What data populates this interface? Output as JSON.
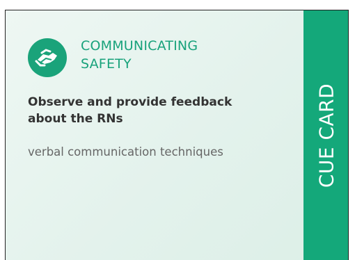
{
  "card": {
    "title_line1": "COMMUNICATING",
    "title_line2": "SAFETY",
    "heading_line1": "Observe and provide feedback",
    "heading_line2": "about the RNs",
    "subtext": "verbal communication techniques",
    "tab_label": "CUE CARD",
    "icon": "handshake-icon",
    "colors": {
      "accent": "#18a27b",
      "tab": "#14a87a",
      "heading": "#333333",
      "subtext": "#666666"
    }
  }
}
